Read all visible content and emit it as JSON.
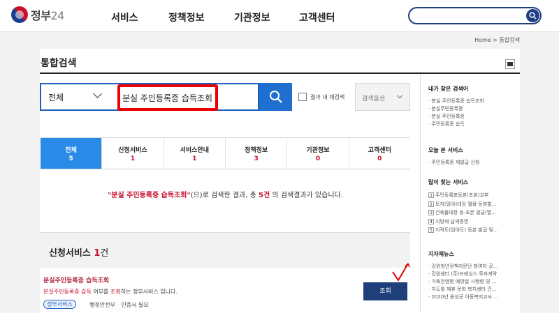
{
  "header": {
    "logo_main": "정부",
    "logo_num": "24",
    "nav": [
      "서비스",
      "정책정보",
      "기관정보",
      "고객센터"
    ]
  },
  "breadcrumb": "Home  >  통합검색",
  "page_title": "통합검색",
  "search": {
    "scope": "전체",
    "query": "분실 주민등록증 습득조회",
    "within_results_label": "결과 내 재검색",
    "options_label": "검색옵션"
  },
  "tabs": [
    {
      "label": "전체",
      "count": "5"
    },
    {
      "label": "신청서비스",
      "count": "1"
    },
    {
      "label": "서비스안내",
      "count": "1"
    },
    {
      "label": "정책정보",
      "count": "3"
    },
    {
      "label": "기관정보",
      "count": "0"
    },
    {
      "label": "고객센터",
      "count": "0"
    }
  ],
  "result_summary": {
    "keyword": "\"분실 주민등록증 습득조회\"",
    "text_mid": "(으)로 검색한 결과, 총",
    "total": "5건",
    "text_end": "의 검색결과가 있습니다."
  },
  "section": {
    "title": "신청서비스",
    "count": "1",
    "unit": "건"
  },
  "item": {
    "title": "분실주민등록증 습득조회",
    "desc_prefix": "분실주민등록증 습득",
    "desc_mid": " 여부를 ",
    "desc_red": "조회",
    "desc_suffix": "하는 정부서비스 입니다.",
    "tag": "정부서비스",
    "agency": "행정안전부",
    "auth": "인증서 필요",
    "button": "조회"
  },
  "sidebar": {
    "my_searches": {
      "title": "내가 찾은 검색어",
      "items": [
        "분실 주민등록증 습득조회",
        "분실주민등록증",
        "분실 주민등록증",
        "주민등록증 습득"
      ]
    },
    "today": {
      "title": "오늘 본 서비스",
      "items": [
        "주민등록증 재발급 신청"
      ]
    },
    "popular": {
      "title": "많이 찾는 서비스",
      "items": [
        {
          "rank": "1",
          "text": "주민등록표등본(초본)교부"
        },
        {
          "rank": "2",
          "text": "토지(임야)대장 열람·등본발..."
        },
        {
          "rank": "3",
          "text": "건축물대장 등·초본 발급(열..."
        },
        {
          "rank": "4",
          "text": "지방세 납세증명"
        },
        {
          "rank": "5",
          "text": "지적도(임야도) 등본 발급 및..."
        }
      ]
    },
    "local_news": {
      "title": "지자체뉴스",
      "items": [
        "강원청년정책자문단 참여자 공...",
        "강원센터 (주)브레싱스 투자계약",
        "가축전염병 예방법 시행령 및 ...",
        "지도를 제휴 문화 복지센터 건...",
        "2020년 용성군 아동복지교사 ..."
      ]
    }
  }
}
